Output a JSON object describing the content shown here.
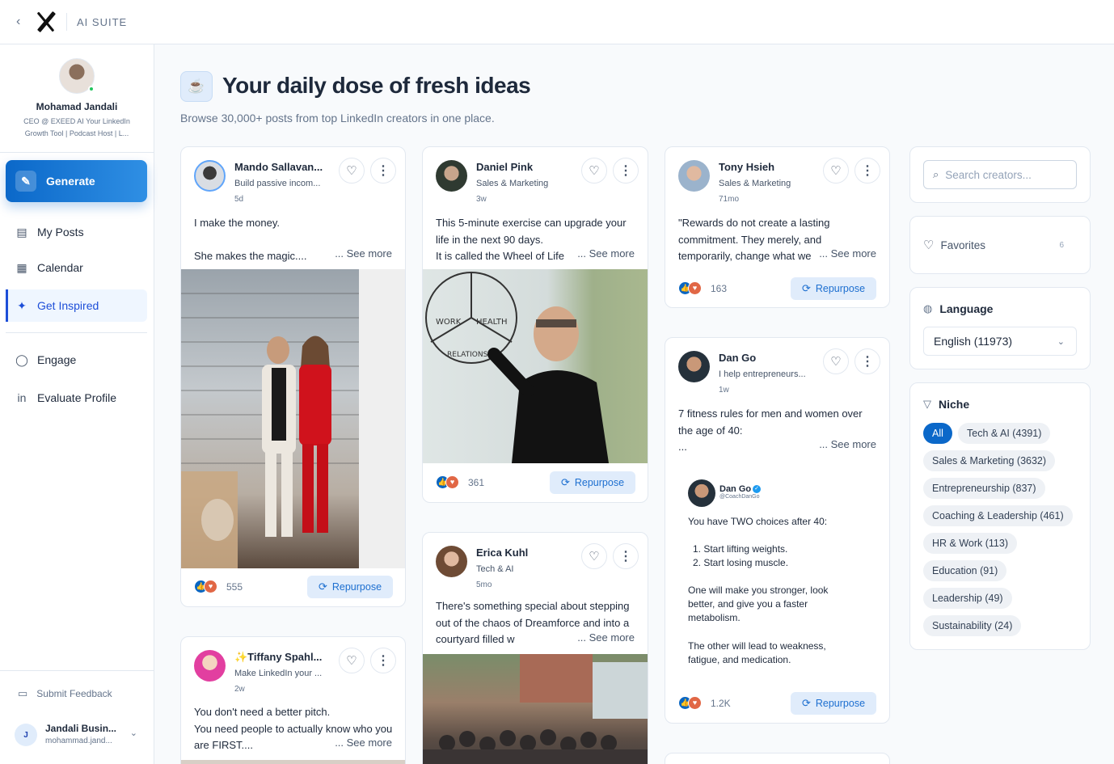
{
  "app": {
    "brand": "AI SUITE"
  },
  "profile": {
    "name": "Mohamad Jandali",
    "bio": "CEO @ EXEED AI Your LinkedIn Growth Tool | Podcast Host | L..."
  },
  "sidebar": {
    "generate_label": "Generate",
    "items": [
      {
        "label": "My Posts",
        "icon": "document-icon"
      },
      {
        "label": "Calendar",
        "icon": "calendar-icon"
      },
      {
        "label": "Get Inspired",
        "icon": "sparkles-icon",
        "active": true
      },
      {
        "label": "Engage",
        "icon": "chat-bubble-icon"
      },
      {
        "label": "Evaluate Profile",
        "icon": "linkedin-icon"
      }
    ],
    "feedback_label": "Submit Feedback",
    "account": {
      "initial": "J",
      "name": "Jandali Busin...",
      "email": "mohammad.jand..."
    }
  },
  "header": {
    "title": "Your daily dose of fresh ideas",
    "subtitle": "Browse 30,000+ posts from top LinkedIn creators in one place."
  },
  "posts": [
    {
      "name": "Mando Sallavan...",
      "role": "Build passive incom...",
      "time": "5d",
      "text": "I make the money.\n\nShe makes the magic....",
      "see_more": "... See more",
      "reactions": "555",
      "repurpose": "Repurpose"
    },
    {
      "name": "✨Tiffany Spahl...",
      "role": "Make LinkedIn your ...",
      "time": "2w",
      "text": "You don't need a better pitch.\nYou need people to actually know who you are FIRST....",
      "see_more": "... See more"
    },
    {
      "name": "Daniel Pink",
      "role": "Sales & Marketing",
      "time": "3w",
      "text": "This 5-minute exercise can upgrade your life in the next 90 days.\nIt is called the Wheel of Life",
      "see_more": "... See more",
      "reactions": "361",
      "repurpose": "Repurpose"
    },
    {
      "name": "Erica Kuhl",
      "role": "Tech & AI",
      "time": "5mo",
      "text": "There's something special about stepping out of the chaos of Dreamforce and into a courtyard filled w",
      "see_more": "... See more"
    },
    {
      "name": "Tony Hsieh",
      "role": "Sales & Marketing",
      "time": "71mo",
      "text": "\"Rewards do not create a lasting commitment. They merely, and temporarily, change what we",
      "see_more": "... See more",
      "reactions": "163",
      "repurpose": "Repurpose"
    },
    {
      "name": "Dan Go",
      "role": "I help entrepreneurs...",
      "time": "1w",
      "text": "7 fitness rules for men and women over the age of 40:\n...",
      "see_more": "... See more",
      "reactions": "1.2K",
      "repurpose": "Repurpose",
      "embed": {
        "name": "Dan Go",
        "handle": "@CoachDanGo",
        "lines": [
          "You have TWO choices after 40:",
          "1. Start lifting weights.",
          "2. Start losing muscle.",
          "One will make you stronger, look better, and give you a faster metabolism.",
          "The other will lead to weakness, fatigue, and medication."
        ]
      }
    }
  ],
  "image_labels": {
    "wheel_work": "WORK",
    "wheel_health": "HEALTH",
    "wheel_rel": "RELATIONS"
  },
  "right": {
    "search_placeholder": "Search creators...",
    "favorites_label": "Favorites",
    "favorites_count": "6",
    "language_title": "Language",
    "language_value": "English (11973)",
    "niche_title": "Niche",
    "niches": [
      "All",
      "Tech & AI (4391)",
      "Sales & Marketing (3632)",
      "Entrepreneurship (837)",
      "Coaching & Leadership (461)",
      "HR & Work (113)",
      "Education (91)",
      "Leadership (49)",
      "Sustainability (24)"
    ]
  },
  "colors": {
    "accent": "#0b68c9",
    "reaction_like": "#0a66c2",
    "reaction_love": "#e16745"
  }
}
